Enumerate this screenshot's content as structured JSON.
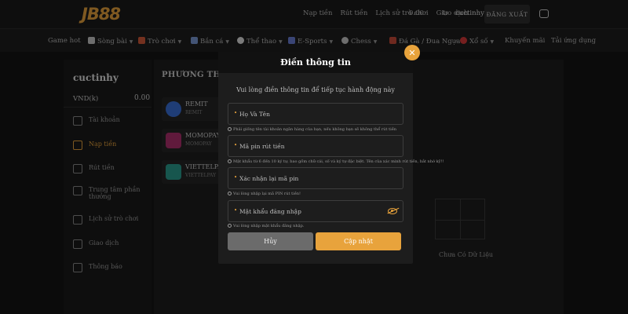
{
  "header": {
    "logo_text": "JB88",
    "links": [
      "Nạp tiền",
      "Rút tiền",
      "Lịch sử trò chơi",
      "Giao dịch"
    ],
    "balance": "0.00",
    "username": "cuctinhy",
    "logout_label": "ĐĂNG XUẤT"
  },
  "nav": {
    "items": [
      {
        "label": "Game hot",
        "icon": "none",
        "dropdown": false
      },
      {
        "label": "Sòng bài",
        "icon": "cards-icon",
        "dropdown": true
      },
      {
        "label": "Trò chơi",
        "icon": "slot-icon",
        "dropdown": true
      },
      {
        "label": "Bắn cá",
        "icon": "fish-icon",
        "dropdown": true
      },
      {
        "label": "Thể thao",
        "icon": "soccer-icon",
        "dropdown": true
      },
      {
        "label": "E-Sports",
        "icon": "gamepad-icon",
        "dropdown": true
      },
      {
        "label": "Chess",
        "icon": "chess-icon",
        "dropdown": true
      },
      {
        "label": "Đá Gà / Đua Ngựa",
        "icon": "rooster-icon",
        "dropdown": true
      },
      {
        "label": "Xổ số",
        "icon": "lottery-icon",
        "dropdown": true
      },
      {
        "label": "Khuyến mãi",
        "icon": "none",
        "dropdown": false
      },
      {
        "label": "Tải ứng dụng",
        "icon": "none",
        "dropdown": false
      }
    ]
  },
  "sidebar": {
    "username": "cuctinhy",
    "currency": "VND(k)",
    "balance": "0.00",
    "items": [
      {
        "label": "Tài khoản",
        "icon": "shield-icon",
        "active": false
      },
      {
        "label": "Nạp tiền",
        "icon": "deposit-icon",
        "active": true
      },
      {
        "label": "Rút tiền",
        "icon": "withdraw-icon",
        "active": false
      },
      {
        "label": "Trung tâm phần thưởng",
        "icon": "gift-icon",
        "active": false
      },
      {
        "label": "Lịch sử trò chơi",
        "icon": "history-icon",
        "active": false
      },
      {
        "label": "Giao dịch",
        "icon": "transaction-icon",
        "active": false
      },
      {
        "label": "Thông báo",
        "icon": "mail-icon",
        "active": false
      }
    ]
  },
  "main": {
    "section_title": "PHƯƠNG THỨC",
    "methods": [
      {
        "name": "REMIT",
        "sub": "REMIT",
        "color": "#3a6fd8"
      },
      {
        "name": "MOMOPAY",
        "sub": "MOMOPAY",
        "color": "#b0306e"
      },
      {
        "name": "VIETTELPAY",
        "sub": "VIETTELPAY",
        "color": "#2a9d8f"
      }
    ],
    "empty_text": "Chưa Có Dữ Liệu"
  },
  "modal": {
    "title": "Điền thông tin",
    "subtitle": "Vui lòng điền thông tin để tiếp tục hành động này",
    "fields": [
      {
        "placeholder": "Họ Và Tên",
        "value": "",
        "hint": "Phải giống tên tài khoản ngân hàng của bạn, nếu không bạn sẽ không thể rút tiền"
      },
      {
        "placeholder": "Mã pin rút tiền",
        "value": "",
        "hint": "Mật khẩu từ 6 đến 10 ký tự, bao gồm chữ cái, số và ký tự đặc biệt. Tên của xác minh rút tiền, bắt nhớ kỹ!!"
      },
      {
        "placeholder": "Xác nhận lại mã pin",
        "value": "",
        "hint": "Vui lòng nhập lại mã PIN rút tiền!"
      },
      {
        "placeholder": "Mật khẩu đăng nhập",
        "value": "",
        "hint": "Vui lòng nhập mật khẩu đăng nhập."
      }
    ],
    "cancel_label": "Hủy",
    "update_label": "Cập nhật"
  },
  "colors": {
    "accent": "#e8a33c",
    "background": "#141414",
    "cancel_button": "#6b6b6b"
  }
}
